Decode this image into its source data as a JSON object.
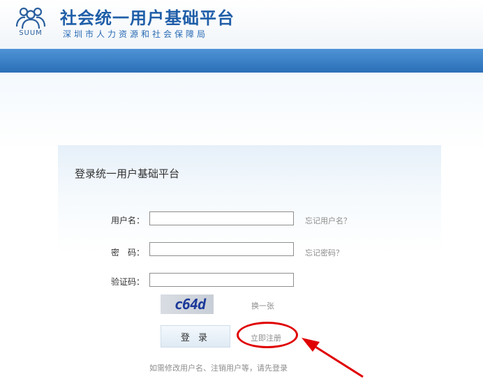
{
  "header": {
    "logo_text": "SUUM",
    "title": "社会统一用户基础平台",
    "subtitle": "深圳市人力资源和社会保障局"
  },
  "login": {
    "title": "登录统一用户基础平台",
    "username_label": "用户名：",
    "username_value": "",
    "forgot_username": "忘记用户名？",
    "password_label": "密　码：",
    "password_value": "",
    "forgot_password": "忘记密码？",
    "captcha_label": "验证码：",
    "captcha_value": "",
    "captcha_text": "c64d",
    "refresh_captcha": "换一张",
    "login_button": "登 录",
    "register_link": "立即注册",
    "footer_note": "如需修改用户名、注销用户等，请先登录"
  },
  "colors": {
    "brand_blue": "#1f5ea8",
    "bar_blue": "#3a80c8",
    "annotation_red": "#e00000"
  }
}
